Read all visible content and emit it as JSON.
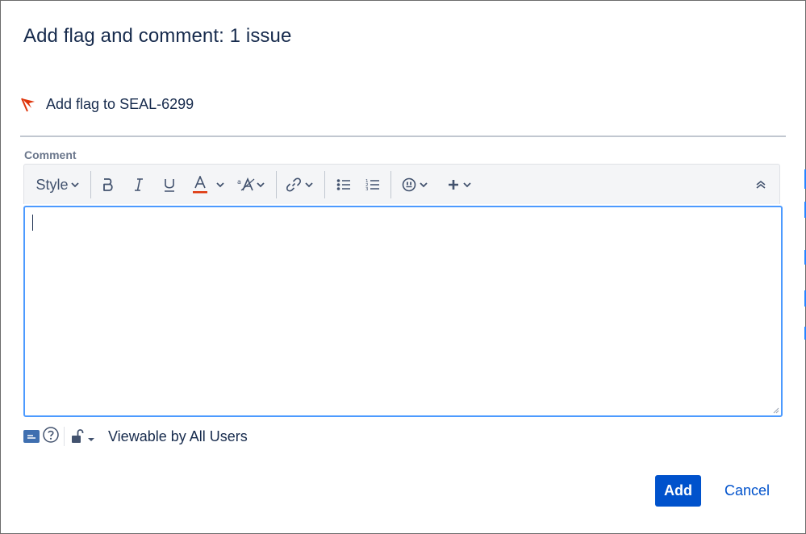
{
  "dialog": {
    "title": "Add flag and comment: 1 issue",
    "flag_label": "Add flag to SEAL-6299",
    "comment_label": "Comment"
  },
  "toolbar": {
    "style_label": "Style",
    "buttons": [
      "bold",
      "italic",
      "underline",
      "text-color",
      "text-color-menu",
      "text-size",
      "link",
      "bullet-list",
      "numbered-list",
      "emoticon",
      "insert-more",
      "collapse-toolbar"
    ],
    "text_color_accent": "#de350b"
  },
  "editor": {
    "value": ""
  },
  "footer_tools": {
    "visibility_text": "Viewable by All Users"
  },
  "actions": {
    "add_label": "Add",
    "cancel_label": "Cancel"
  },
  "colors": {
    "primary": "#0052cc",
    "focus_border": "#4c9aff",
    "flag_red": "#de350b",
    "heading": "#172b4d"
  }
}
